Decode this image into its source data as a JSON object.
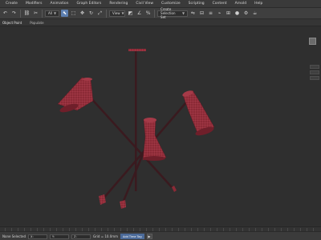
{
  "menubar": {
    "items": [
      "Create",
      "Modifiers",
      "Animation",
      "Graph Editors",
      "Rendering",
      "Civil View",
      "Customize",
      "Scripting",
      "Content",
      "Arnold",
      "Help"
    ]
  },
  "toolbar": {
    "view_dropdown": "View",
    "selection_set_placeholder": "Create Selection Set",
    "icons": [
      "undo-icon",
      "redo-icon",
      "link-icon",
      "unlink-icon",
      "select-icon",
      "region-select-icon",
      "move-icon",
      "rotate-icon",
      "scale-icon",
      "snap-icon",
      "angle-snap-icon",
      "percent-snap-icon",
      "mirror-icon",
      "align-icon",
      "layers-icon",
      "graph-icon",
      "schematic-icon",
      "material-editor-icon",
      "render-setup-icon",
      "render-icon"
    ]
  },
  "ribbon": {
    "tabs": [
      "Object Paint",
      "Populate"
    ]
  },
  "statusbar": {
    "selection_text": "None Selected",
    "field_x": "X:",
    "field_y": "Y:",
    "field_z": "Z:",
    "grid_text": "Grid = 10.0mm",
    "key_button": "Add Time Tag",
    "play_icon": "play-icon"
  },
  "colors": {
    "lamp": "#8b2a36",
    "lamp_wire": "#c14a5a",
    "rod": "#3a1a1f",
    "viewport_bg": "#2f2f2f"
  }
}
